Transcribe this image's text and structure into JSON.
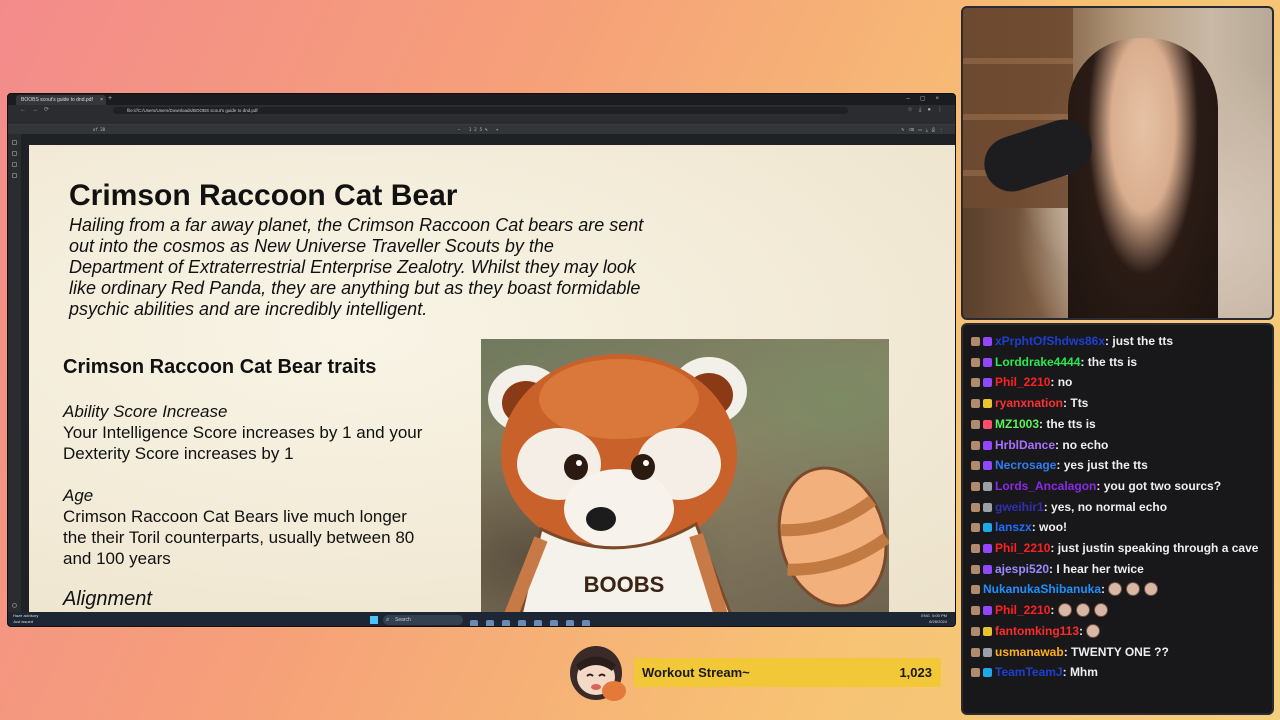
{
  "browser": {
    "tab_title": "BOOBS scout's guide to dnd.pdf",
    "new_tab": "+",
    "url": "file:///C:/Users/Users/Downloads/BOOBS scout's guide to dnd.pdf",
    "bookmarks": [
      "WATCH BEFORE WOR...",
      "Milanote",
      "Patreon",
      "Google Calendar",
      "Weekly Stream Sched...",
      "Stream Manager",
      "Channel Analytics",
      "Channel - Twitch",
      "Dashboard / Strea...",
      "Playlist Summary",
      "Nightbot - Command...",
      "Blerp Dashboard",
      "Clip Queue",
      "SimplePDF - PDF editor",
      "Creation Kit",
      "Discord StreamKit Ove...",
      "Other Bookmarks"
    ],
    "pdf_page_label": "of 28",
    "pdf_zoom": "125%"
  },
  "pdf": {
    "title": "Crimson Raccoon Cat Bear",
    "intro": "Hailing from a far away planet, the Crimson Raccoon Cat bears are sent out into the cosmos as New Universe Traveller Scouts by the Department of Extraterrestrial Enterprise Zealotry. Whilst they may look like ordinary Red Panda, they are anything but as they boast formidable psychic abilities and are incredibly intelligent.",
    "traits_heading": "Crimson Raccoon Cat Bear traits",
    "traits": [
      {
        "heading": "Ability Score Increase",
        "body": "Your Intelligence Score increases by 1 and your Dexterity Score increases by 1"
      },
      {
        "heading": "Age",
        "body": "Crimson Raccoon Cat Bears live much longer the their Toril counterparts, usually between 80 and 100 years"
      },
      {
        "heading": "Alignment",
        "body": ""
      }
    ],
    "image_shirt_text": "BOOBS"
  },
  "taskbar": {
    "weather_line1": "Haze advisory",
    "weather_line2": "Just issued",
    "search_placeholder": "Search",
    "lang": "ENG",
    "time": "5:00 PM",
    "date": "6/28/2024"
  },
  "chat": {
    "messages": [
      {
        "user": "xPrphtOfShdws86x",
        "color": "#1e3fd1",
        "badge": "#9147ff",
        "text": "just the tts"
      },
      {
        "user": "Lorddrake4444",
        "color": "#2ce84f",
        "badge": "#9147ff",
        "text": "the tts is"
      },
      {
        "user": "Phil_2210",
        "color": "#ff2020",
        "badge": "#9147ff",
        "text": "no"
      },
      {
        "user": "ryanxnation",
        "color": "#ff3030",
        "badge": "#e9c430",
        "text": "Tts"
      },
      {
        "user": "MZ1003",
        "color": "#5cf25c",
        "badge": "#ff4d6d",
        "text": "the tts is"
      },
      {
        "user": "HrblDance",
        "color": "#a970ff",
        "badge": "#9147ff",
        "text": "no echo"
      },
      {
        "user": "Necrosage",
        "color": "#2f7df3",
        "badge": "#9147ff",
        "text": "yes just the tts"
      },
      {
        "user": "Lords_Ancalagon",
        "color": "#8a2be2",
        "badge": "#9aa0a6",
        "text": "you got two sourcs?"
      },
      {
        "user": "gweihir1",
        "color": "#2f2fb5",
        "badge": "#9aa0a6",
        "text": "yes, no normal echo"
      },
      {
        "user": "lanszx",
        "color": "#1f6fff",
        "badge": "#1fa8e8",
        "text": "woo!"
      },
      {
        "user": "Phil_2210",
        "color": "#ff2020",
        "badge": "#9147ff",
        "text": "just justin speaking through a cave"
      },
      {
        "user": "ajespi520",
        "color": "#9b8cff",
        "badge": "#9147ff",
        "text": "I hear her twice"
      },
      {
        "user": "NukanukaShibanuka",
        "color": "#1e90ff",
        "badge": "",
        "text": "",
        "emotes": 3
      },
      {
        "user": "Phil_2210",
        "color": "#ff2020",
        "badge": "#9147ff",
        "text": "",
        "emotes": 3
      },
      {
        "user": "fantomking113",
        "color": "#ff2a2a",
        "badge": "#e9c430",
        "text": "",
        "emotes": 1
      },
      {
        "user": "usmanawab",
        "color": "#ffb020",
        "badge": "#9aa0a6",
        "text": "TWENTY ONE ??"
      },
      {
        "user": "TeamTeamJ",
        "color": "#1e3fd1",
        "badge": "#1fa8e8",
        "text": "Mhm"
      }
    ]
  },
  "goal": {
    "title": "Workout Stream~",
    "value": "1,023"
  }
}
